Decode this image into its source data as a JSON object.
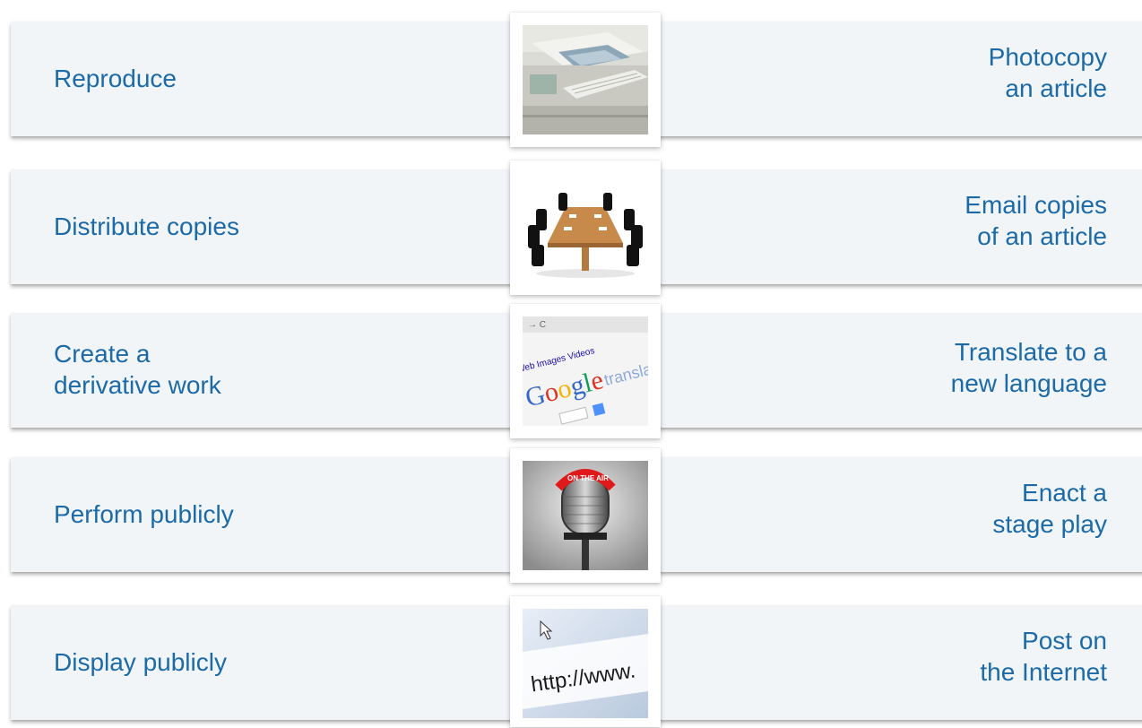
{
  "rows": [
    {
      "left_label": "Reproduce",
      "right_label": "Photocopy\nan article",
      "image": "photocopier-icon"
    },
    {
      "left_label": "Distribute copies",
      "right_label": "Email copies\nof an article",
      "image": "meeting-table-icon"
    },
    {
      "left_label": "Create a\nderivative work",
      "right_label": "Translate to a\nnew language",
      "image": "google-translate-icon"
    },
    {
      "left_label": "Perform publicly",
      "right_label": "Enact a\nstage play",
      "image": "on-air-microphone-icon"
    },
    {
      "left_label": "Display publicly",
      "right_label": "Post on\nthe Internet",
      "image": "browser-url-icon"
    }
  ],
  "image_text": {
    "translate_tabs": [
      "Web",
      "Images",
      "Videos"
    ],
    "translate_brand": "Google",
    "translate_word": "translate",
    "on_air": "ON THE AIR",
    "url": "http://www."
  },
  "colors": {
    "panel": "#f1f5f8",
    "text": "#1c6aa8"
  }
}
